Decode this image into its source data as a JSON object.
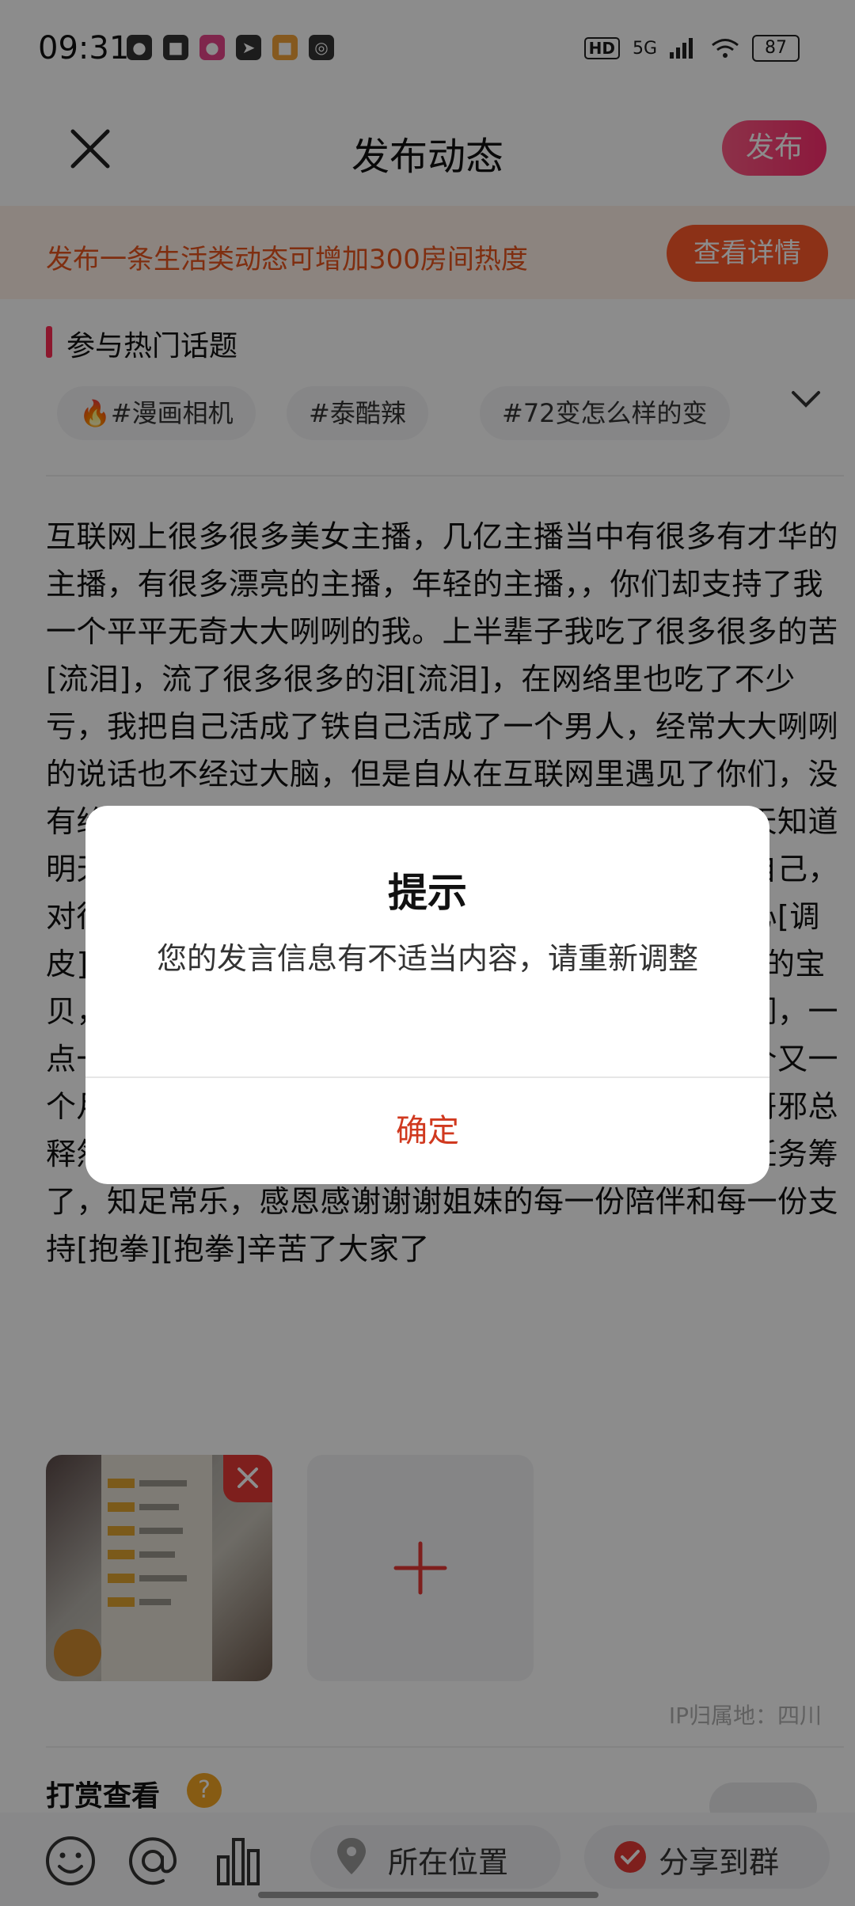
{
  "status_bar": {
    "time": "09:31",
    "network": "5G",
    "hd": "HD",
    "battery": "87"
  },
  "header": {
    "title": "发布动态",
    "publish_label": "发布"
  },
  "banner": {
    "text": "发布一条生活类动态可增加300房间热度",
    "button_label": "查看详情"
  },
  "topics": {
    "heading": "参与热门话题",
    "chips": [
      "#漫画相机",
      "#泰酷辣",
      "#72变怎么样的变"
    ]
  },
  "post": {
    "text": "互联网上很多很多美女主播，几亿主播当中有很多有才华的主播，有很多漂亮的主播，年轻的主播，，你们却支持了我一个平平无奇大大咧咧的我。上半辈子我吃了很多很多的苦[流泪]，流了很多很多的泪[流泪]，在网络里也吃了不少亏，我把自己活成了铁自己活成了一个男人，经常大大咧咧的说话也不经过大脑，但是自从在互联网里遇见了你们，没有给过我任何太多的压力，在这里没有过多的要求，天知道明天会是什么样子，我只知道努力干好自己，对得起自己，对得起你们，不愿辜负每一个人，不愿违背自己的初心[调皮][调皮][调皮][调皮][调皮]我们家每一个家人都是我的宝贝，你们都是最好的。谢谢一直陪伴我支持我的家人们，一点一滴的滴和包容，支持，陪伴你们陪着我走过了一个又一个月，在最后的时候是却没有放弃我。神秘人许哥沧哥邪总释然大炮八戒紫轩月月所有好哥哥齐心协力的给我把任务筹了，知足常乐，感恩感谢谢谢姐妹的每一份陪伴和每一份支持[抱拳][抱拳]辛苦了大家了"
  },
  "media": {
    "ip_location": "IP归属地：四川"
  },
  "reward": {
    "label": "打赏查看",
    "help_mark": "?"
  },
  "toolbar": {
    "location_label": "所在位置",
    "share_label": "分享到群"
  },
  "dialog": {
    "title": "提示",
    "message": "您的发言信息有不适当内容，请重新调整",
    "confirm_label": "确定"
  },
  "colors": {
    "accent": "#ff2d6f",
    "banner_accent": "#ff5a2a",
    "dialog_confirm": "#d0391f"
  }
}
